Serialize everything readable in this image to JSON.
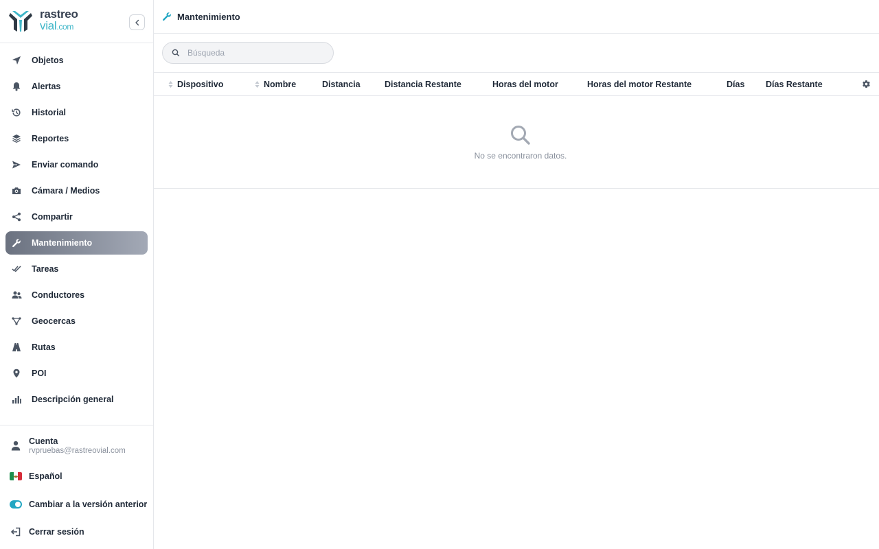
{
  "brand": {
    "line1": "rastreo",
    "line2": "vial",
    "line2_suffix": ".com",
    "accent": "#3fb6c8"
  },
  "sidebar": {
    "collapse_icon": "chevron-left-icon",
    "items": [
      {
        "label": "Objetos",
        "icon": "location-arrow-icon"
      },
      {
        "label": "Alertas",
        "icon": "bell-icon"
      },
      {
        "label": "Historial",
        "icon": "history-icon"
      },
      {
        "label": "Reportes",
        "icon": "layers-icon"
      },
      {
        "label": "Enviar comando",
        "icon": "send-icon"
      },
      {
        "label": "Cámara / Medios",
        "icon": "camera-icon"
      },
      {
        "label": "Compartir",
        "icon": "share-icon"
      },
      {
        "label": "Mantenimiento",
        "icon": "wrench-icon",
        "active": true
      },
      {
        "label": "Tareas",
        "icon": "double-check-icon"
      },
      {
        "label": "Conductores",
        "icon": "users-icon"
      },
      {
        "label": "Geocercas",
        "icon": "polygon-icon"
      },
      {
        "label": "Rutas",
        "icon": "road-icon"
      },
      {
        "label": "POI",
        "icon": "map-pin-icon"
      },
      {
        "label": "Descripción general",
        "icon": "bar-chart-icon"
      }
    ],
    "bottom": {
      "account_label": "Cuenta",
      "account_email": "rvpruebas@rastreovial.com",
      "language_label": "Español",
      "switch_version_label": "Cambiar a la versión anterior",
      "logout_label": "Cerrar sesión"
    }
  },
  "header": {
    "title": "Mantenimiento",
    "icon": "wrench-icon"
  },
  "search": {
    "placeholder": "Búsqueda"
  },
  "table": {
    "columns": [
      {
        "label": "Dispositivo",
        "sortable": true
      },
      {
        "label": "Nombre",
        "sortable": true
      },
      {
        "label": "Distancia",
        "sortable": false
      },
      {
        "label": "Distancia Restante",
        "sortable": false
      },
      {
        "label": "Horas del motor",
        "sortable": false
      },
      {
        "label": "Horas del motor Restante",
        "sortable": false
      },
      {
        "label": "Días",
        "sortable": false
      },
      {
        "label": "Días Restante",
        "sortable": false
      }
    ],
    "rows": [],
    "empty_message": "No se encontraron datos."
  },
  "colors": {
    "active_nav_start": "#6b7280",
    "active_nav_end": "#a3a9b6",
    "toggle_on": "#22a6c2",
    "icon_gray": "#4b5563"
  }
}
